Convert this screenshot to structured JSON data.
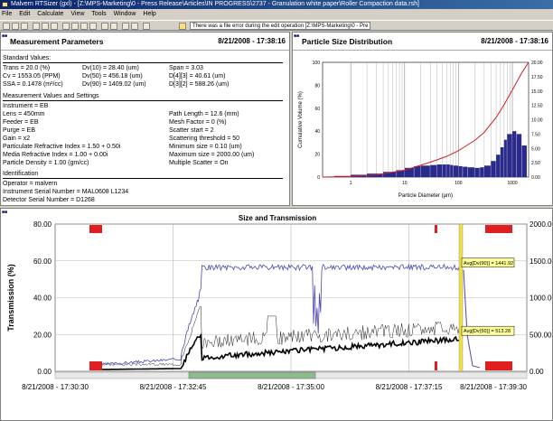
{
  "window": {
    "title": "Malvern RTSizer (gxl) - [Z:\\MPS-Marketing\\0 - Press Release\\Articles\\IN PROGRESS\\2737 - Granulation white paper\\Roller Compaction data.rsh]"
  },
  "menu": [
    "File",
    "Edit",
    "Calculate",
    "View",
    "Tools",
    "Window",
    "Help"
  ],
  "toolbar": {
    "status": "There was a file error during the edit operation [Z:\\MPS-Marketing\\0 - Pre"
  },
  "measurement": {
    "title": "Measurement Parameters",
    "date": "8/21/2008 - 17:38:16",
    "std_heading": "Standard Values:",
    "trans": "Trans = 20.0 (%)",
    "dv10": "Dv(10) = 28.40 (um)",
    "span": "Span = 3.03",
    "cv": "Cv = 1553.05 (PPM)",
    "dv50": "Dv(50) = 456.18 (um)",
    "d43": "D[4][3] = 40.61 (um)",
    "ssa": "SSA = 0.1478 (m²/cc)",
    "dv90": "Dv(90) = 1409.02 (um)",
    "d32": "D[3][2] = 588.26 (um)",
    "settings_heading": "Measurement Values and Settings",
    "instrument": "Instrument = EB",
    "lens": "Lens = 450mm",
    "path": "Path Length = 12.6 (mm)",
    "feeder": "Feeder = EB",
    "mesh": "Mesh Factor = 0 (%)",
    "purge": "Purge = EB",
    "scatter": "Scatter start = 2",
    "gain": "Gain = x2",
    "thresh": "Scattering threshold = 50",
    "pri": "Particulate Refractive Index = 1.50 + 0.50i",
    "minsize": "Minimum size = 0.10 (um)",
    "mri": "Media Refractive Index = 1.00 + 0.00i",
    "maxsize": "Maximum size = 2000.00 (um)",
    "density": "Particle Density = 1.00 (gm/cc)",
    "multi": "Multiple Scatter = On",
    "id_heading": "Identification",
    "operator": "Operator = malvern",
    "iserial": "Instrument Serial Number = MAL0608 L1234",
    "dserial": "Detector Serial Number = D1268"
  },
  "psd": {
    "title": "Particle Size Distribution",
    "date": "8/21/2008 - 17:38:16",
    "chart_data": {
      "type": "bar",
      "xlabel": "Particle Diameter (µm)",
      "ylabel": "Cumulative Volume (%)",
      "x_ticks": [
        "1",
        "10",
        "100",
        "1000"
      ],
      "y_ticks": [
        "0",
        "20",
        "40",
        "60",
        "80",
        "100"
      ],
      "y2_ticks": [
        "0.00",
        "2.50",
        "5.00",
        "7.50",
        "10.00",
        "12.50",
        "15.00",
        "17.50",
        "20.00"
      ],
      "frequency_bins_um": [
        0.5,
        1,
        2,
        4,
        7,
        10,
        15,
        20,
        30,
        40,
        50,
        60,
        70,
        80,
        100,
        120,
        150,
        200,
        250,
        300,
        400,
        500,
        600,
        700,
        800,
        1000,
        1200,
        1500
      ],
      "frequency_values": [
        0.2,
        0.4,
        0.6,
        0.9,
        1.2,
        1.6,
        1.9,
        2.0,
        2.1,
        2.2,
        2.2,
        2.2,
        2.1,
        2.0,
        1.9,
        1.8,
        1.7,
        1.6,
        1.7,
        2.0,
        2.8,
        3.9,
        5.2,
        6.5,
        7.5,
        8.0,
        7.5,
        5.5
      ],
      "cumulative_x_um": [
        0.3,
        1,
        3,
        10,
        30,
        60,
        100,
        200,
        300,
        500,
        700,
        1000,
        1500,
        2000
      ],
      "cumulative_y": [
        0,
        0.5,
        2,
        6,
        13,
        18,
        23,
        32,
        39,
        52,
        63,
        76,
        91,
        100
      ],
      "colors": {
        "bars": "#2a2a8c",
        "cumulative": "#cc2222"
      }
    }
  },
  "timeplot": {
    "title": "Size and Transmission",
    "ylabel": "Transmission (%)",
    "chart_data": {
      "type": "line",
      "y_ticks": [
        "0.00",
        "20.00",
        "40.00",
        "60.00",
        "80.00"
      ],
      "y2_ticks": [
        "0.00",
        "500.00",
        "1000.00",
        "1500.00",
        "2000.00"
      ],
      "x_ticks": [
        "8/21/2008 - 17:30:30",
        "8/21/2008 - 17:32:45",
        "8/21/2008 - 17:35:00",
        "8/21/2008 - 17:37:15",
        "8/21/2008 - 17:39:30"
      ],
      "cursor_labels": {
        "dv90": "Avg[Dv(90)] = 1441.92",
        "dv50": "Avg[Dv(50)] = 513.28"
      },
      "series": [
        {
          "name": "Dv(90)",
          "color": "#4a4ab0"
        },
        {
          "name": "Dv(50)",
          "color": "#000000"
        },
        {
          "name": "Transmission",
          "color": "#4a4ab0"
        }
      ]
    }
  }
}
